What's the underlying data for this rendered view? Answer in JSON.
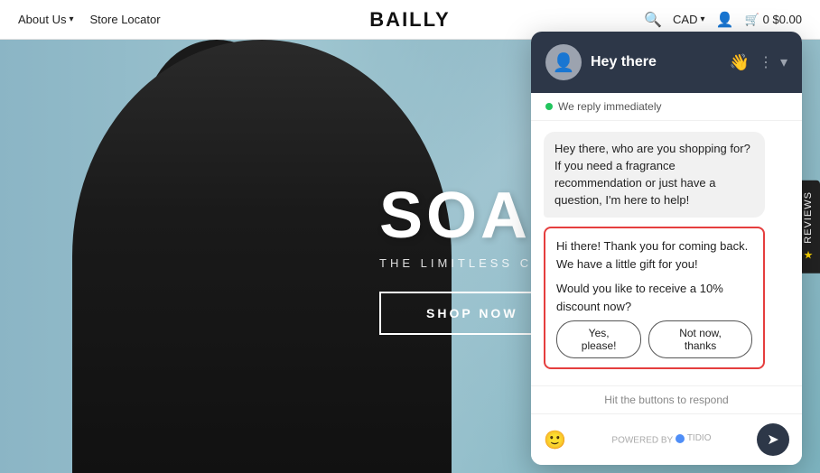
{
  "navbar": {
    "about_label": "About Us",
    "store_label": "Store Locator",
    "logo": "BAILLY",
    "currency": "CAD",
    "cart_label": "0  $0.00"
  },
  "hero": {
    "title": "SOAR",
    "subtitle": "THE LIMITLESS COLLECTION",
    "shop_btn": "SHOP NOW"
  },
  "reviews_tab": {
    "label": "★ REVIEWS"
  },
  "chat": {
    "header_title": "Hey there",
    "header_emoji": "👋",
    "status": "We reply immediately",
    "messages": [
      {
        "text": "Hey there, who are you shopping for? If you need a fragrance recommendation or just have a question, I'm here to help!"
      }
    ],
    "highlighted_msg1": "Hi there! Thank you for coming back. We have a little gift for you!",
    "highlighted_msg2": "Would you like to receive a 10% discount now?",
    "btn_yes": "Yes, please!",
    "btn_no": "Not now, thanks",
    "hint": "Hit the buttons to respond",
    "powered_by": "POWERED BY",
    "tidio": "TIDIO"
  }
}
